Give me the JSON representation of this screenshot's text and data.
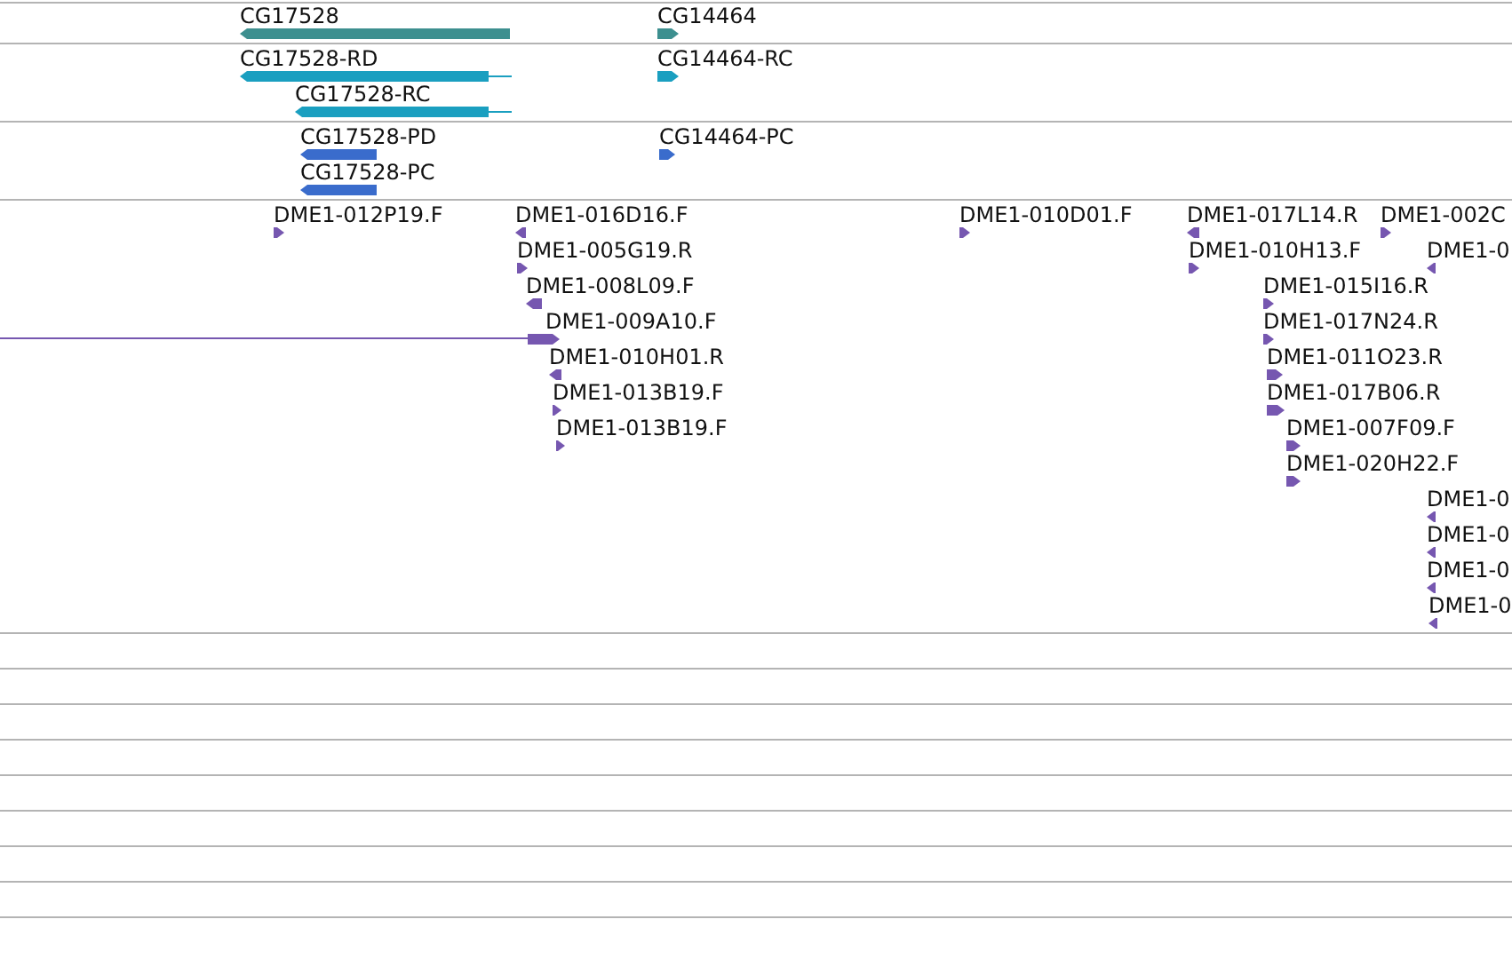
{
  "tracks": [
    {
      "kind": "gene",
      "features": [
        {
          "label": "CG17528",
          "reverse": true,
          "kind": "single"
        },
        {
          "label": "CG14464",
          "reverse": false,
          "kind": "single"
        }
      ]
    },
    {
      "kind": "transcript",
      "features": [
        {
          "label": "CG17528-RD",
          "reverse": true,
          "kind": "single"
        },
        {
          "label": "CG17528-RC",
          "reverse": true,
          "kind": "single"
        },
        {
          "label": "CG14464-RC",
          "reverse": false,
          "kind": "single"
        }
      ]
    },
    {
      "kind": "protein",
      "features": [
        {
          "label": "CG17528-PD",
          "reverse": true,
          "kind": "single"
        },
        {
          "label": "CG17528-PC",
          "reverse": true,
          "kind": "single"
        },
        {
          "label": "CG14464-PC",
          "reverse": false,
          "kind": "single"
        }
      ]
    },
    {
      "kind": "clone",
      "features": [
        {
          "label": "DME1-012P19.F",
          "reverse": false,
          "kind": "single"
        },
        {
          "label": "DME1-016D16.F",
          "reverse": true,
          "kind": "single"
        },
        {
          "label": "DME1-005G19.R",
          "reverse": false,
          "kind": "single"
        },
        {
          "label": "DME1-008L09.F",
          "reverse": true,
          "kind": "single"
        },
        {
          "label": "DME1-009A10.F",
          "reverse": false,
          "kind": "paired"
        },
        {
          "label": "DME1-010H01.R",
          "reverse": true,
          "kind": "single"
        },
        {
          "label": "DME1-013B19.F",
          "reverse": false,
          "kind": "single"
        },
        {
          "label": "DME1-013B19.F",
          "reverse": false,
          "kind": "single"
        },
        {
          "label": "DME1-010D01.F",
          "reverse": false,
          "kind": "single"
        },
        {
          "label": "DME1-017L14.R",
          "reverse": true,
          "kind": "single"
        },
        {
          "label": "DME1-002C",
          "reverse": false,
          "kind": "single"
        },
        {
          "label": "DME1-010H13.F",
          "reverse": false,
          "kind": "single"
        },
        {
          "label": "DME1-0",
          "reverse": true,
          "kind": "single"
        },
        {
          "label": "DME1-015I16.R",
          "reverse": false,
          "kind": "single"
        },
        {
          "label": "DME1-017N24.R",
          "reverse": false,
          "kind": "single"
        },
        {
          "label": "DME1-011O23.R",
          "reverse": false,
          "kind": "single"
        },
        {
          "label": "DME1-017B06.R",
          "reverse": false,
          "kind": "single"
        },
        {
          "label": "DME1-007F09.F",
          "reverse": false,
          "kind": "single"
        },
        {
          "label": "DME1-020H22.F",
          "reverse": false,
          "kind": "single"
        },
        {
          "label": "DME1-0",
          "reverse": true,
          "kind": "single"
        },
        {
          "label": "DME1-0",
          "reverse": true,
          "kind": "single"
        },
        {
          "label": "DME1-0",
          "reverse": true,
          "kind": "single"
        },
        {
          "label": "DME1-0",
          "reverse": true,
          "kind": "single"
        }
      ]
    }
  ]
}
